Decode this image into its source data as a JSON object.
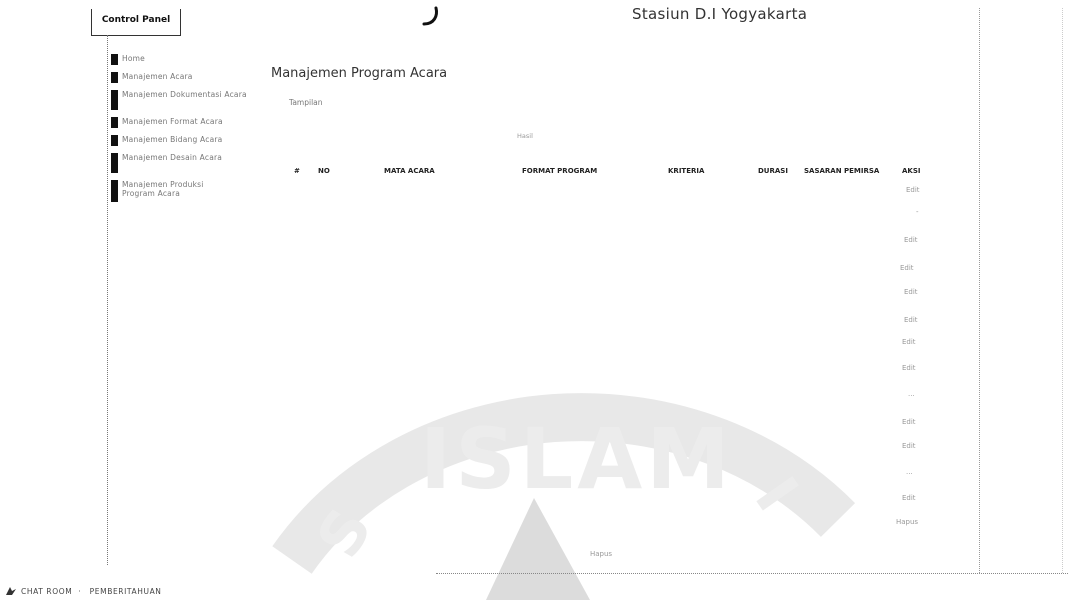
{
  "header": {
    "control_panel": "Control Panel",
    "site_title": "Stasiun D.I Yogyakarta"
  },
  "sidebar": {
    "items": [
      {
        "label": "Home"
      },
      {
        "label": "Manajemen Acara"
      },
      {
        "label": "Manajemen Dokumentasi Acara"
      },
      {
        "label": "Manajemen Format Acara"
      },
      {
        "label": "Manajemen Bidang Acara"
      },
      {
        "label": "Manajemen Desain Acara"
      },
      {
        "label": "Manajemen Produksi Program Acara"
      }
    ]
  },
  "main": {
    "title": "Manajemen Program Acara",
    "tampil": "Tampilan",
    "center_note": "Hasil"
  },
  "table": {
    "headers": [
      "#",
      "NO",
      "MATA ACARA",
      "FORMAT PROGRAM",
      "KRITERIA",
      "DURASI",
      "SASARAN PEMIRSA",
      "AKSI"
    ],
    "aksi_values": [
      "Edit",
      "-",
      "Edit",
      "Edit",
      "Edit",
      "Edit",
      "Edit",
      "Edit",
      "...",
      "Edit",
      "Edit",
      "...",
      "Edit",
      "Hapus"
    ]
  },
  "bottom": {
    "center_text": "Hapus"
  },
  "footer": {
    "left_text": "CHAT ROOM",
    "right_text": "PEMBERITAHUAN"
  },
  "watermark": {
    "text": "ISLAM",
    "letters": [
      "S",
      "I"
    ]
  },
  "colors": {
    "sidebar_bar": "#111111",
    "watermark": "#e6e6e6"
  }
}
